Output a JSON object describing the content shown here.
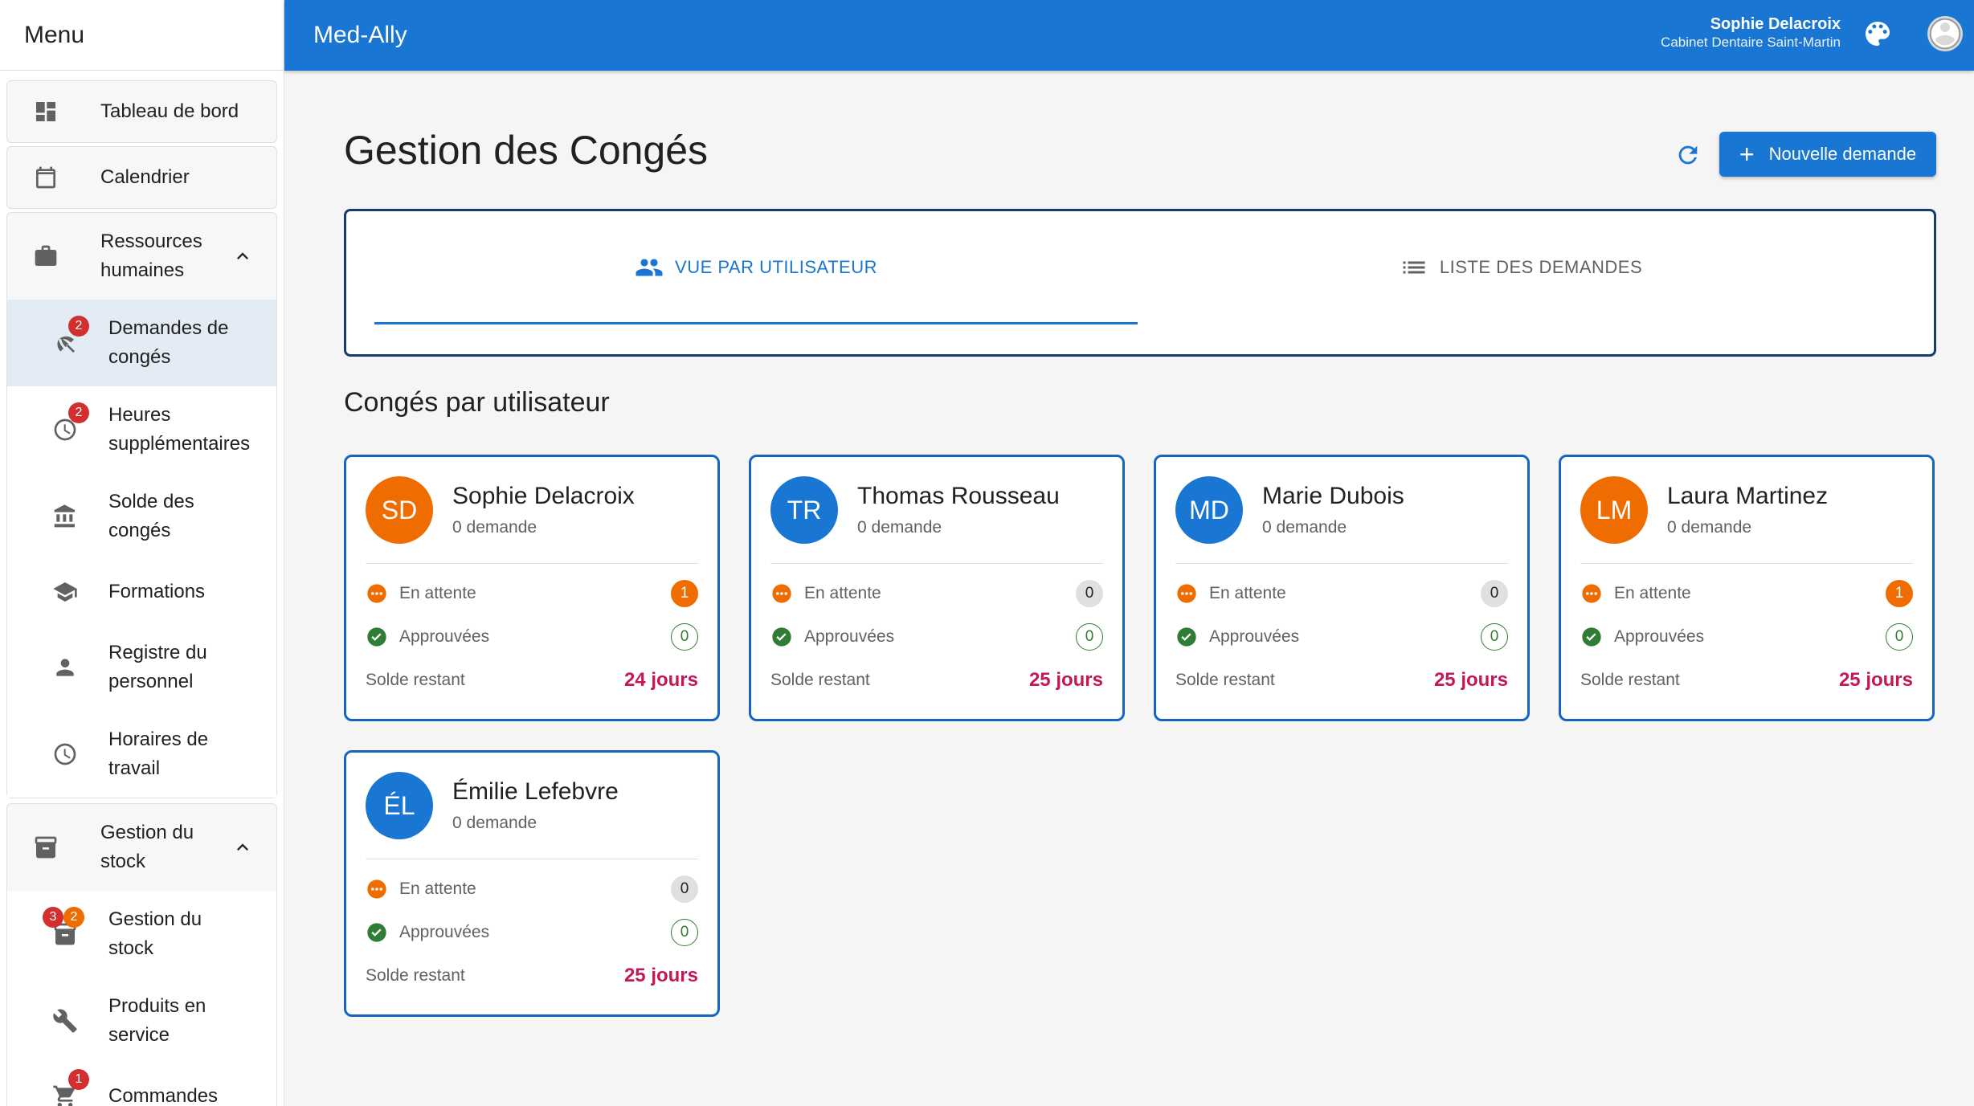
{
  "sidebar": {
    "title": "Menu",
    "items": {
      "dashboard": "Tableau de bord",
      "calendar": "Calendrier",
      "hr": "Ressources humaines",
      "stock_group": "Gestion du stock"
    },
    "hr_sub": {
      "leave_requests": "Demandes de congés",
      "overtime": "Heures supplémentaires",
      "leave_balance": "Solde des congés",
      "trainings": "Formations",
      "staff_register": "Registre du personnel",
      "schedules": "Horaires de travail"
    },
    "stock_sub": {
      "stock": "Gestion du stock",
      "products": "Produits en service",
      "orders": "Commandes"
    },
    "badges": {
      "leave_requests": "2",
      "overtime": "2",
      "stock_red": "3",
      "stock_orange": "2",
      "orders": "1"
    }
  },
  "topbar": {
    "app_title": "Med-Ally",
    "user_name": "Sophie Delacroix",
    "user_org": "Cabinet Dentaire Saint-Martin"
  },
  "main": {
    "title": "Gestion des Congés",
    "new_request_label": "Nouvelle demande",
    "tabs": {
      "by_user": "VUE PAR UTILISATEUR",
      "list": "LISTE DES DEMANDES"
    },
    "section_title": "Congés par utilisateur",
    "labels": {
      "pending": "En attente",
      "approved": "Approuvées",
      "balance": "Solde restant"
    },
    "users": [
      {
        "initials": "SD",
        "name": "Sophie Delacroix",
        "count": "0 demande",
        "pending": "1",
        "approved": "0",
        "balance": "24 jours",
        "color": "#ef6c00"
      },
      {
        "initials": "TR",
        "name": "Thomas Rousseau",
        "count": "0 demande",
        "pending": "0",
        "approved": "0",
        "balance": "25 jours",
        "color": "#1976d2"
      },
      {
        "initials": "MD",
        "name": "Marie Dubois",
        "count": "0 demande",
        "pending": "0",
        "approved": "0",
        "balance": "25 jours",
        "color": "#1976d2"
      },
      {
        "initials": "LM",
        "name": "Laura Martinez",
        "count": "0 demande",
        "pending": "1",
        "approved": "0",
        "balance": "25 jours",
        "color": "#ef6c00"
      },
      {
        "initials": "ÉL",
        "name": "Émilie Lefebvre",
        "count": "0 demande",
        "pending": "0",
        "approved": "0",
        "balance": "25 jours",
        "color": "#1976d2"
      }
    ]
  },
  "colors": {
    "primary": "#1976d2",
    "accent_orange": "#ef6c00",
    "balance_pink": "#c2185b",
    "approved_green": "#2e7d32",
    "badge_red": "#d32f2f"
  }
}
